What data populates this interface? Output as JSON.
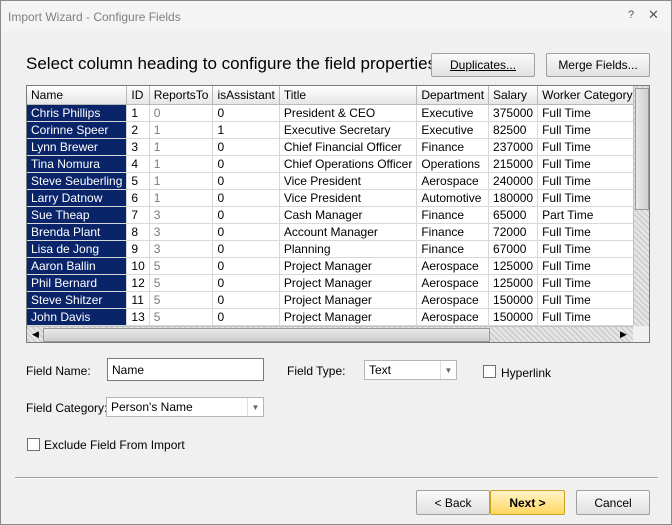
{
  "window": {
    "title": "Import Wizard - Configure Fields",
    "help_glyph": "?",
    "close_glyph": "✕"
  },
  "header": {
    "heading": "Select column heading to configure the field properties.",
    "duplicates_label": "Duplicates...",
    "merge_label": "Merge Fields..."
  },
  "grid": {
    "columns": [
      "Name",
      "ID",
      "ReportsTo",
      "isAssistant",
      "Title",
      "Department",
      "Salary",
      "Worker Category"
    ],
    "rows": [
      [
        "Chris Phillips",
        "1",
        "0",
        "0",
        "President & CEO",
        "Executive",
        "375000",
        "Full Time"
      ],
      [
        "Corinne Speer",
        "2",
        "1",
        "1",
        "Executive Secretary",
        "Executive",
        "82500",
        "Full Time"
      ],
      [
        "Lynn Brewer",
        "3",
        "1",
        "0",
        "Chief Financial Officer",
        "Finance",
        "237000",
        "Full Time"
      ],
      [
        "Tina Nomura",
        "4",
        "1",
        "0",
        "Chief Operations Officer",
        "Operations",
        "215000",
        "Full Time"
      ],
      [
        "Steve Seuberling",
        "5",
        "1",
        "0",
        "Vice President",
        "Aerospace",
        "240000",
        "Full Time"
      ],
      [
        "Larry Datnow",
        "6",
        "1",
        "0",
        "Vice President",
        "Automotive",
        "180000",
        "Full Time"
      ],
      [
        "Sue Theap",
        "7",
        "3",
        "0",
        "Cash Manager",
        "Finance",
        "65000",
        "Part Time"
      ],
      [
        "Brenda Plant",
        "8",
        "3",
        "0",
        "Account Manager",
        "Finance",
        "72000",
        "Full Time"
      ],
      [
        "Lisa de Jong",
        "9",
        "3",
        "0",
        "Planning",
        "Finance",
        "67000",
        "Full Time"
      ],
      [
        "Aaron Ballin",
        "10",
        "5",
        "0",
        "Project Manager",
        "Aerospace",
        "125000",
        "Full Time"
      ],
      [
        "Phil Bernard",
        "12",
        "5",
        "0",
        "Project Manager",
        "Aerospace",
        "125000",
        "Full Time"
      ],
      [
        "Steve Shitzer",
        "11",
        "5",
        "0",
        "Project Manager",
        "Aerospace",
        "150000",
        "Full Time"
      ],
      [
        "John Davis",
        "13",
        "5",
        "0",
        "Project Manager",
        "Aerospace",
        "150000",
        "Full Time"
      ]
    ],
    "scroll_left_glyph": "◀",
    "scroll_right_glyph": "▶"
  },
  "form": {
    "field_name_label": "Field Name:",
    "field_name_value": "Name",
    "field_type_label": "Field Type:",
    "field_type_value": "Text",
    "hyperlink_label": "Hyperlink",
    "hyperlink_checked": false,
    "field_category_label": "Field Category:",
    "field_category_value": "Person's Name",
    "exclude_label": "Exclude Field From Import",
    "exclude_checked": false,
    "dropdown_glyph": "▼"
  },
  "footer": {
    "back_label": "< Back",
    "next_label": "Next >",
    "cancel_label": "Cancel"
  },
  "colors": {
    "selected_column": "#0a246a",
    "next_button": "#ffd760"
  }
}
